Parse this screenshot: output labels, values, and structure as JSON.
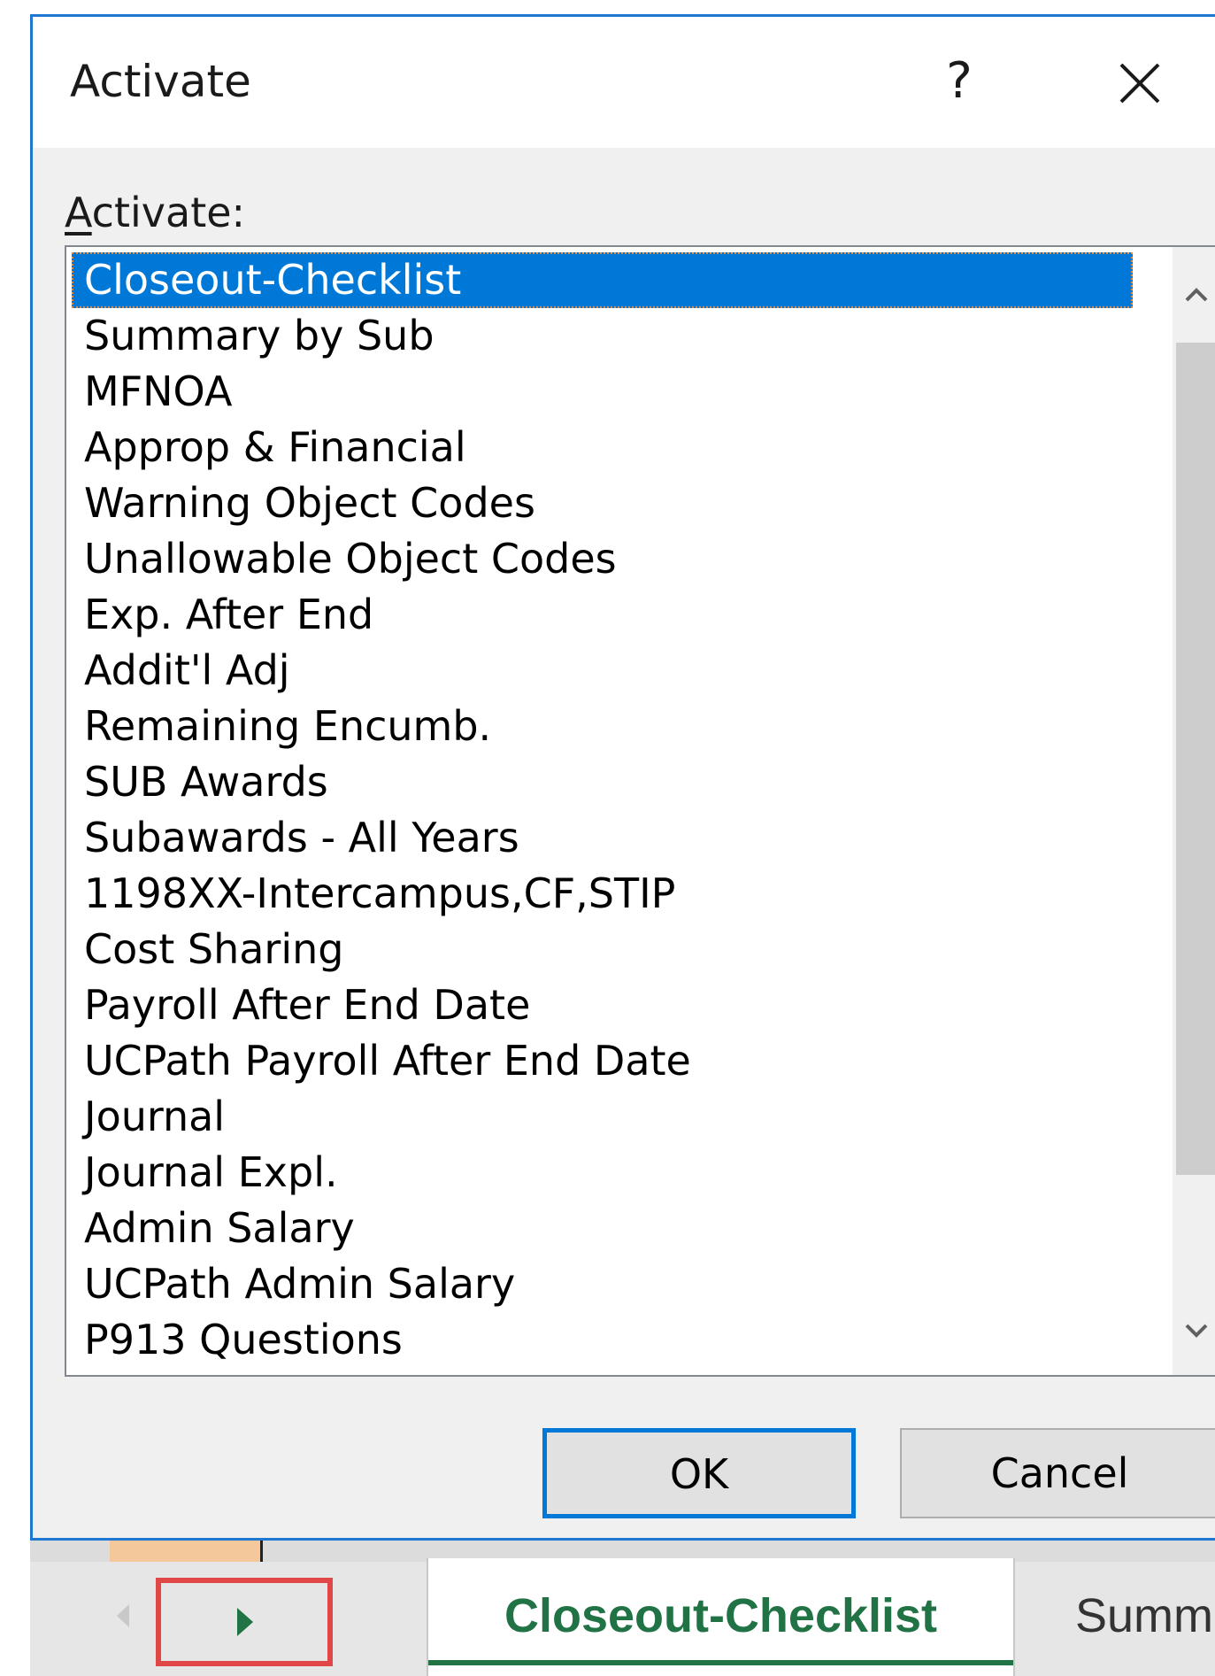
{
  "dialog": {
    "title": "Activate",
    "help_label": "?",
    "label_access_key": "A",
    "label_rest": "ctivate:",
    "items": [
      "Closeout-Checklist",
      "Summary by Sub",
      "MFNOA",
      "Approp & Financial",
      "Warning Object Codes",
      "Unallowable Object Codes",
      "Exp. After End",
      "Addit'l Adj",
      "Remaining Encumb.",
      "SUB Awards",
      "Subawards - All Years",
      "1198XX-Intercampus,CF,STIP",
      "Cost Sharing",
      "Payroll After End Date",
      "UCPath Payroll After End Date",
      "Journal",
      "Journal Expl.",
      "Admin Salary",
      "UCPath Admin Salary",
      "P913 Questions"
    ],
    "selected_item": "Closeout-Checklist",
    "ok_label": "OK",
    "cancel_label": "Cancel"
  },
  "sheet_tabs": {
    "active": "Closeout-Checklist",
    "next_partial": "Summ"
  },
  "colors": {
    "accent": "#0078d7",
    "excel_green": "#217346",
    "highlight_box": "#e04848"
  }
}
